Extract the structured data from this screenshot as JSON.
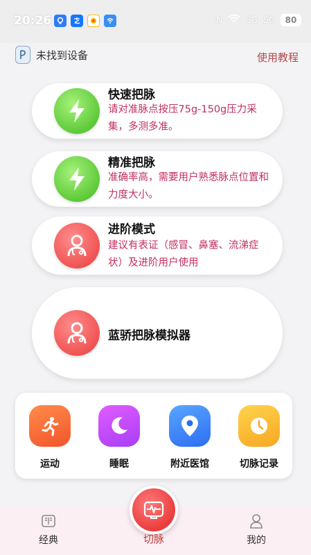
{
  "status_bar": {
    "time": "20:26",
    "nfc": "N",
    "signal_1": "5G",
    "signal_2": "5G",
    "battery": "80"
  },
  "header": {
    "device_status": "未找到设备",
    "tutorial_link": "使用教程"
  },
  "cards": [
    {
      "title": "快速把脉",
      "description": "请对准脉点按压75g-150g压力采集，多测多准。",
      "icon": "lightning-icon"
    },
    {
      "title": "精准把脉",
      "description": "准确率高，需要用户熟悉脉点位置和力度大小。",
      "icon": "lightning-icon"
    },
    {
      "title": "进阶模式",
      "description": "建议有表证（感冒、鼻塞、流涕症状）及进阶用户使用",
      "icon": "doctor-icon"
    },
    {
      "title": "蓝骄把脉模拟器",
      "description": "",
      "icon": "doctor-icon"
    }
  ],
  "quick_actions": [
    {
      "label": "运动",
      "icon": "running-icon"
    },
    {
      "label": "睡眠",
      "icon": "moon-icon"
    },
    {
      "label": "附近医馆",
      "icon": "location-pin-icon"
    },
    {
      "label": "切脉记录",
      "icon": "clock-icon"
    }
  ],
  "bottom_nav": {
    "classics": "经典",
    "pulse": "切脉",
    "mine": "我的"
  },
  "colors": {
    "accent_red": "#ea3d3d",
    "description_text": "#c0305e",
    "green_badge": "#5fca3a"
  }
}
